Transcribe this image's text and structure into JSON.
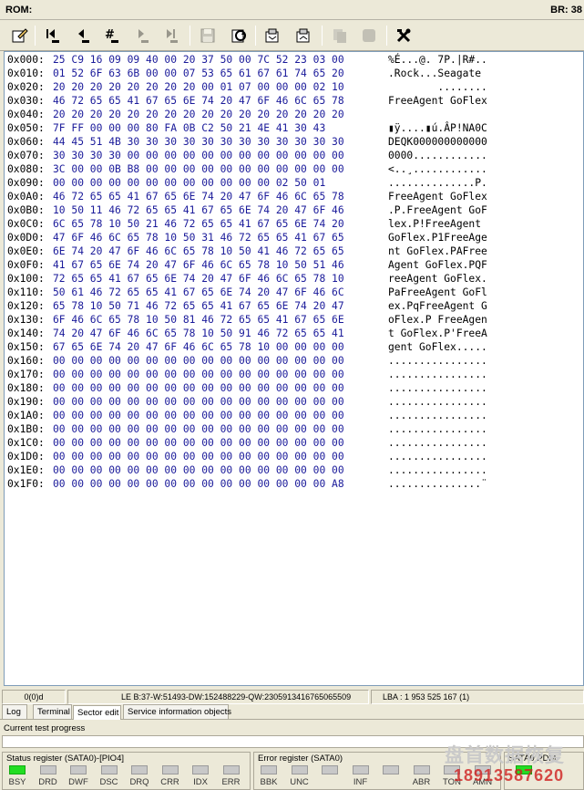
{
  "title": {
    "left": "ROM:",
    "right": "BR: 38"
  },
  "toolbar": {
    "icons": [
      "edit-icon",
      "goto-first-icon",
      "goto-prev-icon",
      "goto-sector-icon",
      "goto-next-icon",
      "goto-last-icon",
      "save-icon",
      "refresh-icon",
      "read-to-file-icon",
      "write-from-file-icon",
      "copy-icon",
      "stop-icon",
      "tools-icon"
    ]
  },
  "hex": {
    "rows": [
      {
        "off": "0x000:",
        "bytes": "25 C9 16 09 09 40 00 20 37 50 00 7C 52 23 03 00",
        "ascii": "%É...@. 7P.|R#.."
      },
      {
        "off": "0x010:",
        "bytes": "01 52 6F 63 6B 00 00 07 53 65 61 67 61 74 65 20",
        "ascii": ".Rock...Seagate "
      },
      {
        "off": "0x020:",
        "bytes": "20 20 20 20 20 20 20 20 00 01 07 00 00 00 02 10",
        "ascii": "        ........"
      },
      {
        "off": "0x030:",
        "bytes": "46 72 65 65 41 67 65 6E 74 20 47 6F 46 6C 65 78",
        "ascii": "FreeAgent GoFlex"
      },
      {
        "off": "0x040:",
        "bytes": "20 20 20 20 20 20 20 20 20 20 20 20 20 20 20 20",
        "ascii": "                "
      },
      {
        "off": "0x050:",
        "bytes": "7F FF 00 00 00 80 FA 0B C2 50 21 4E 41 30 43",
        "ascii": "▮ÿ....▮ú.ÂP!NA0C"
      },
      {
        "off": "0x060:",
        "bytes": "44 45 51 4B 30 30 30 30 30 30 30 30 30 30 30 30",
        "ascii": "DEQK000000000000"
      },
      {
        "off": "0x070:",
        "bytes": "30 30 30 30 00 00 00 00 00 00 00 00 00 00 00 00",
        "ascii": "0000............"
      },
      {
        "off": "0x080:",
        "bytes": "3C 00 00 0B B8 00 00 00 00 00 00 00 00 00 00 00",
        "ascii": "<..¸............"
      },
      {
        "off": "0x090:",
        "bytes": "00 00 00 00 00 00 00 00 00 00 00 00 02 50 01",
        "ascii": "..............P."
      },
      {
        "off": "0x0A0:",
        "bytes": "46 72 65 65 41 67 65 6E 74 20 47 6F 46 6C 65 78",
        "ascii": "FreeAgent GoFlex"
      },
      {
        "off": "0x0B0:",
        "bytes": "10 50 11 46 72 65 65 41 67 65 6E 74 20 47 6F 46",
        "ascii": ".P.FreeAgent GoF"
      },
      {
        "off": "0x0C0:",
        "bytes": "6C 65 78 10 50 21 46 72 65 65 41 67 65 6E 74 20",
        "ascii": "lex.P!FreeAgent "
      },
      {
        "off": "0x0D0:",
        "bytes": "47 6F 46 6C 65 78 10 50 31 46 72 65 65 41 67 65",
        "ascii": "GoFlex.P1FreeAge"
      },
      {
        "off": "0x0E0:",
        "bytes": "6E 74 20 47 6F 46 6C 65 78 10 50 41 46 72 65 65",
        "ascii": "nt GoFlex.PAFree"
      },
      {
        "off": "0x0F0:",
        "bytes": "41 67 65 6E 74 20 47 6F 46 6C 65 78 10 50 51 46",
        "ascii": "Agent GoFlex.PQF"
      },
      {
        "off": "0x100:",
        "bytes": "72 65 65 41 67 65 6E 74 20 47 6F 46 6C 65 78 10",
        "ascii": "reeAgent GoFlex."
      },
      {
        "off": "0x110:",
        "bytes": "50 61 46 72 65 65 41 67 65 6E 74 20 47 6F 46 6C",
        "ascii": "PaFreeAgent GoFl"
      },
      {
        "off": "0x120:",
        "bytes": "65 78 10 50 71 46 72 65 65 41 67 65 6E 74 20 47",
        "ascii": "ex.PqFreeAgent G"
      },
      {
        "off": "0x130:",
        "bytes": "6F 46 6C 65 78 10 50 81 46 72 65 65 41 67 65 6E",
        "ascii": "oFlex.P FreeAgen"
      },
      {
        "off": "0x140:",
        "bytes": "74 20 47 6F 46 6C 65 78 10 50 91 46 72 65 65 41",
        "ascii": "t GoFlex.P'FreeA"
      },
      {
        "off": "0x150:",
        "bytes": "67 65 6E 74 20 47 6F 46 6C 65 78 10 00 00 00 00",
        "ascii": "gent GoFlex....."
      },
      {
        "off": "0x160:",
        "bytes": "00 00 00 00 00 00 00 00 00 00 00 00 00 00 00 00",
        "ascii": "................"
      },
      {
        "off": "0x170:",
        "bytes": "00 00 00 00 00 00 00 00 00 00 00 00 00 00 00 00",
        "ascii": "................"
      },
      {
        "off": "0x180:",
        "bytes": "00 00 00 00 00 00 00 00 00 00 00 00 00 00 00 00",
        "ascii": "................"
      },
      {
        "off": "0x190:",
        "bytes": "00 00 00 00 00 00 00 00 00 00 00 00 00 00 00 00",
        "ascii": "................"
      },
      {
        "off": "0x1A0:",
        "bytes": "00 00 00 00 00 00 00 00 00 00 00 00 00 00 00 00",
        "ascii": "................"
      },
      {
        "off": "0x1B0:",
        "bytes": "00 00 00 00 00 00 00 00 00 00 00 00 00 00 00 00",
        "ascii": "................"
      },
      {
        "off": "0x1C0:",
        "bytes": "00 00 00 00 00 00 00 00 00 00 00 00 00 00 00 00",
        "ascii": "................"
      },
      {
        "off": "0x1D0:",
        "bytes": "00 00 00 00 00 00 00 00 00 00 00 00 00 00 00 00",
        "ascii": "................"
      },
      {
        "off": "0x1E0:",
        "bytes": "00 00 00 00 00 00 00 00 00 00 00 00 00 00 00 00",
        "ascii": "................"
      },
      {
        "off": "0x1F0:",
        "bytes": "00 00 00 00 00 00 00 00 00 00 00 00 00 00 00 A8",
        "ascii": "...............¨"
      }
    ]
  },
  "statusbar": {
    "position": "0(0)d",
    "le": "LE B:37-W:51493-DW:152488229-QW:2305913416765065509",
    "lba": "LBA : 1 953 525 167 (1)"
  },
  "tabs": [
    {
      "label": "Log"
    },
    {
      "label": "Terminal"
    },
    {
      "label": "Sector edit"
    },
    {
      "label": "Service information objects"
    }
  ],
  "progress": {
    "label": "Current test progress",
    "fraction": 0
  },
  "status_register": {
    "title": "Status register (SATA0)-[PIO4]",
    "leds": [
      {
        "label": "BSY",
        "on": true
      },
      {
        "label": "DRD",
        "on": false
      },
      {
        "label": "DWF",
        "on": false
      },
      {
        "label": "DSC",
        "on": false
      },
      {
        "label": "DRQ",
        "on": false
      },
      {
        "label": "CRR",
        "on": false
      },
      {
        "label": "IDX",
        "on": false
      },
      {
        "label": "ERR",
        "on": false
      }
    ]
  },
  "error_register": {
    "title": "Error register (SATA0)",
    "leds": [
      {
        "label": "BBK",
        "on": false
      },
      {
        "label": "UNC",
        "on": false
      },
      {
        "label": "",
        "on": false
      },
      {
        "label": "INF",
        "on": false
      },
      {
        "label": "",
        "on": false
      },
      {
        "label": "ABR",
        "on": false
      },
      {
        "label": "TON",
        "on": false
      },
      {
        "label": "AMN",
        "on": false
      }
    ]
  },
  "power_panel": {
    "title": "SATA0 PDM",
    "leds": [
      {
        "label": "",
        "on": true
      }
    ]
  },
  "watermark": {
    "line1": "盘首数据恢复",
    "line2": "18913587620"
  },
  "colors": {
    "hex_bytes": "#1a1a9a",
    "led_on": "#22dd22",
    "led_off": "#c8c8c8"
  }
}
